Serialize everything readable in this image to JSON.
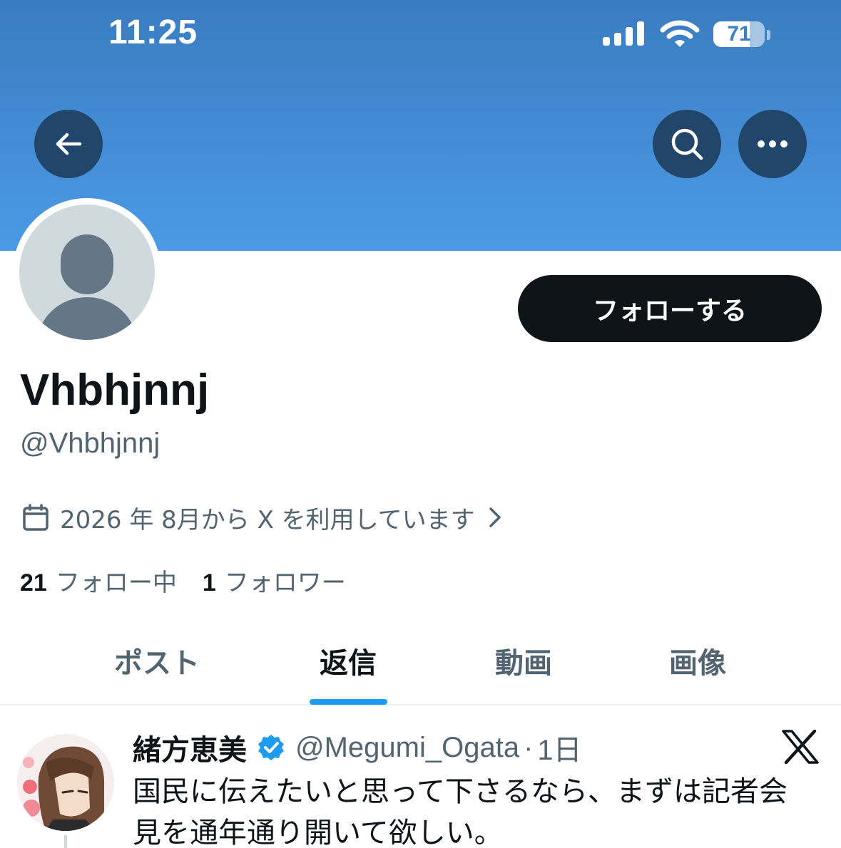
{
  "status_bar": {
    "time": "11:25",
    "battery_level": "71",
    "battery_fraction": 0.71,
    "signal_bars": 4,
    "icons": [
      "cellular-signal-icon",
      "wifi-icon",
      "battery-icon"
    ]
  },
  "header": {
    "back_icon": "arrow-left-icon",
    "search_icon": "search-icon",
    "more_icon": "ellipsis-icon",
    "banner_color": "#4b9ae6"
  },
  "profile": {
    "display_name": "Vhbhjnnj",
    "handle": "@Vhbhjnnj",
    "joined": "2026 年 8月から X を利用しています",
    "follow_button": "フォローする",
    "following_count": "21",
    "following_label": "フォロー中",
    "followers_count": "1",
    "followers_label": "フォロワー"
  },
  "tabs": [
    {
      "label": "ポスト",
      "active": false
    },
    {
      "label": "返信",
      "active": true
    },
    {
      "label": "動画",
      "active": false
    },
    {
      "label": "画像",
      "active": false
    }
  ],
  "post": {
    "author_name": "緒方恵美",
    "author_handle": "@Megumi_Ogata",
    "dot": "·",
    "time": "1日",
    "verified": true,
    "body": "国民に伝えたいと思って下さるなら、まずは記者会見を通年通り開いて欲しい。"
  },
  "colors": {
    "accent": "#1d9bf0",
    "text_primary": "#0f1419",
    "text_secondary": "#536471",
    "button_dark": "#0f1419",
    "header_button": "#22456a"
  }
}
